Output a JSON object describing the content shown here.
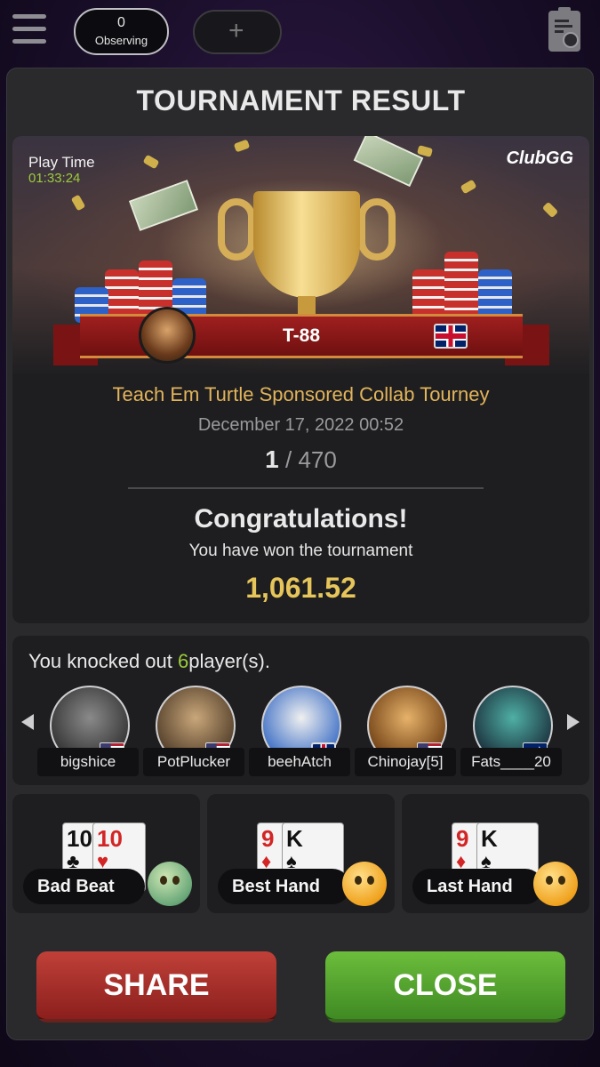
{
  "topbar": {
    "observing_count": "0",
    "observing_label": "Observing",
    "add_label": "+"
  },
  "panel": {
    "title": "TOURNAMENT RESULT"
  },
  "banner": {
    "play_time_label": "Play Time",
    "play_time_value": "01:33:24",
    "logo": "ClubGG",
    "player_name": "T-88",
    "player_flag": "uk-flag-icon"
  },
  "result": {
    "tournament_name": "Teach Em Turtle Sponsored Collab Tourney",
    "date": "December 17, 2022 00:52",
    "place": "1",
    "place_separator": "/",
    "total_players": "470",
    "congrats": "Congratulations!",
    "won_text": "You have won the tournament",
    "prize": "1,061.52"
  },
  "knockout": {
    "prefix": "You knocked out",
    "count": "6",
    "suffix": "player(s).",
    "players": [
      {
        "name": "bigshice",
        "flag": "us-flag-icon"
      },
      {
        "name": "PotPlucker",
        "flag": "us-flag-icon"
      },
      {
        "name": "beehAtch",
        "flag": "uk-flag-icon"
      },
      {
        "name": "Chinojay[5]",
        "flag": "us-flag-icon"
      },
      {
        "name": "Fats____20",
        "flag": "au-flag-icon"
      }
    ]
  },
  "hands": [
    {
      "label": "Bad Beat",
      "cards": [
        {
          "rank": "10",
          "suit": "♣",
          "color": "black"
        },
        {
          "rank": "10",
          "suit": "♥",
          "color": "red"
        }
      ]
    },
    {
      "label": "Best Hand",
      "cards": [
        {
          "rank": "9",
          "suit": "♦",
          "color": "red"
        },
        {
          "rank": "K",
          "suit": "♠",
          "color": "black"
        }
      ]
    },
    {
      "label": "Last Hand",
      "cards": [
        {
          "rank": "9",
          "suit": "♦",
          "color": "red"
        },
        {
          "rank": "K",
          "suit": "♠",
          "color": "black"
        }
      ]
    }
  ],
  "buttons": {
    "share": "SHARE",
    "close": "CLOSE"
  },
  "colors": {
    "accent_gold": "#e2b45b",
    "prize_gold": "#e6c55a",
    "green": "#9ccc3c",
    "share_red": "#a3302b",
    "close_green": "#55a332"
  }
}
